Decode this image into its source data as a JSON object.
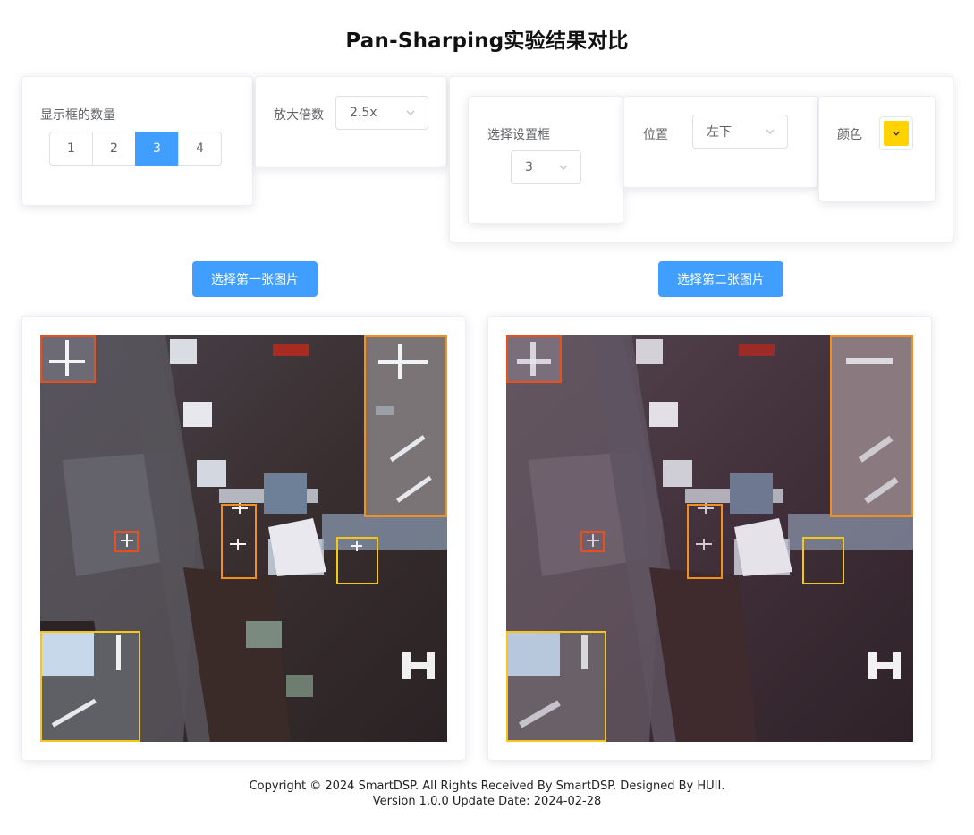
{
  "page": {
    "title": "Pan-Sharping实验结果对比"
  },
  "controls": {
    "count": {
      "label": "显示框的数量",
      "options": [
        "1",
        "2",
        "3",
        "4"
      ],
      "selected": "3"
    },
    "zoom": {
      "label": "放大倍数",
      "value": "2.5x"
    },
    "settings": {
      "select_box": {
        "label": "选择设置框",
        "value": "3"
      },
      "position": {
        "label": "位置",
        "value": "左下"
      },
      "color": {
        "label": "颜色",
        "value": "#ffd200"
      }
    }
  },
  "actions": {
    "choose_first": "选择第一张图片",
    "choose_second": "选择第二张图片"
  },
  "colors": {
    "primary": "#409eff",
    "box1": "#e8501f",
    "box2": "#f19021",
    "box3": "#f5c518"
  },
  "footer": {
    "line1": "Copyright © 2024 SmartDSP. All Rights Received By SmartDSP. Designed By HUII.",
    "line2": "Version 1.0.0 Update Date: 2024-02-28"
  }
}
